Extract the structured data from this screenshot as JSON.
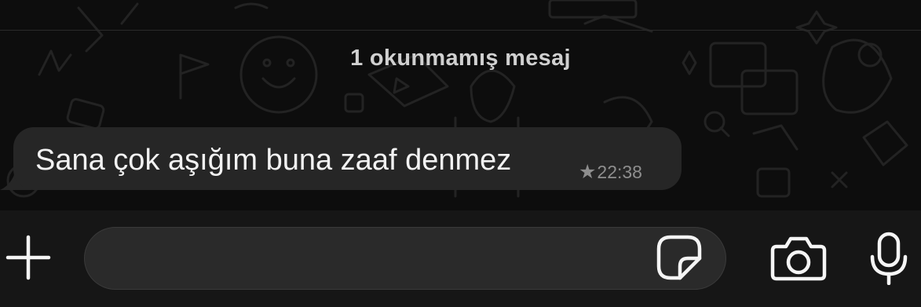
{
  "chat": {
    "unread_divider": "1 okunmamış mesaj",
    "messages": [
      {
        "text": "Sana çok aşığım buna zaaf denmez",
        "time": "22:38",
        "starred": true,
        "direction": "incoming"
      }
    ]
  },
  "composer": {
    "input_value": "",
    "icons": [
      "plus-icon",
      "sticker-icon",
      "camera-icon",
      "microphone-icon"
    ]
  },
  "colors": {
    "background": "#0d0d0d",
    "bubble": "#262626",
    "bottom_bar": "#161616",
    "input": "#2a2a2a",
    "text": "#f2f2f2",
    "meta": "#8e8e8e"
  }
}
